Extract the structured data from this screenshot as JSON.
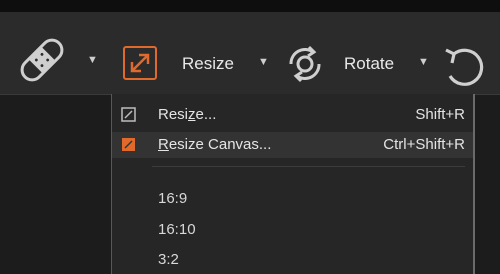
{
  "toolbar": {
    "resize_label": "Resize",
    "rotate_label": "Rotate",
    "icons": [
      "bandage-icon",
      "resize-icon",
      "rotate-icon",
      "undo-icon"
    ],
    "accent_color": "#e06a2c"
  },
  "menu": {
    "resize": {
      "label_pre": "Resi",
      "label_u": "z",
      "label_post": "e...",
      "shortcut": "Shift+R"
    },
    "resize_canvas": {
      "label_u": "R",
      "label_post": "esize Canvas...",
      "shortcut": "Ctrl+Shift+R"
    },
    "ratios": [
      "16:9",
      "16:10",
      "3:2"
    ]
  }
}
